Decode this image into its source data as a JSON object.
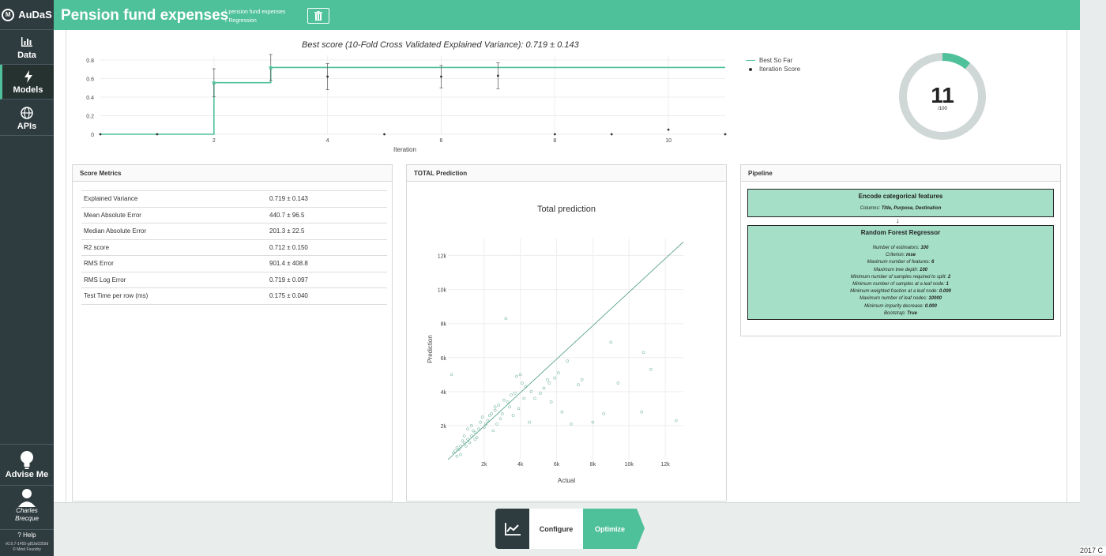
{
  "app": {
    "name": "AuDaS",
    "version": "v0.9.7-1455-g81fa0359d",
    "company": "© Mind Foundry",
    "year_fragment": "2017 C"
  },
  "sidebar": {
    "items": [
      {
        "label": "Data",
        "icon": "bar-chart-icon"
      },
      {
        "label": "Models",
        "icon": "lightning-icon"
      },
      {
        "label": "APIs",
        "icon": "globe-icon"
      }
    ],
    "advise_label": "Advise Me",
    "user_first": "Charles",
    "user_last": "Brecque",
    "help_label": "Help"
  },
  "header": {
    "title": "Pension fund expenses",
    "tags": [
      "pension fund expenses",
      "Regression"
    ]
  },
  "iteration_chart": {
    "title": "Best score (10-Fold Cross Validated Explained Variance): 0.719 ± 0.143",
    "xlabel": "Iteration",
    "y_ticks": [
      "0",
      "0.2",
      "0.4",
      "0.6",
      "0.8"
    ],
    "x_ticks": [
      "2",
      "4",
      "6",
      "8",
      "10"
    ],
    "legend": [
      "Best So Far",
      "Iteration Score"
    ]
  },
  "progress": {
    "current": "11",
    "total": "/100",
    "fraction": 0.11
  },
  "score_metrics": {
    "title": "Score Metrics",
    "rows": [
      {
        "name": "Explained Variance",
        "value": "0.719 ± 0.143"
      },
      {
        "name": "Mean Absolute Error",
        "value": "440.7 ± 96.5"
      },
      {
        "name": "Median Absolute Error",
        "value": "201.3 ± 22.5"
      },
      {
        "name": "R2 score",
        "value": "0.712 ± 0.150"
      },
      {
        "name": "RMS Error",
        "value": "901.4 ± 408.8"
      },
      {
        "name": "RMS Log Error",
        "value": "0.719 ± 0.097"
      },
      {
        "name": "Test Time per row (ms)",
        "value": "0.175 ± 0.040"
      }
    ]
  },
  "prediction": {
    "panel_title": "TOTAL Prediction",
    "plot_title": "Total prediction",
    "xlabel": "Actual",
    "ylabel": "Prediction",
    "x_ticks": [
      "2k",
      "4k",
      "6k",
      "8k",
      "10k",
      "12k"
    ],
    "y_ticks": [
      "2k",
      "4k",
      "6k",
      "8k",
      "10k",
      "12k"
    ]
  },
  "pipeline": {
    "title": "Pipeline",
    "step1": {
      "title": "Encode categorical features",
      "columns_label": "Columns:",
      "columns_value": "Title, Purpose, Destination"
    },
    "arrow": "↓",
    "step2": {
      "title": "Random Forest Regressor",
      "params": [
        {
          "k": "Number of estimators:",
          "v": "100"
        },
        {
          "k": "Criterion:",
          "v": "mse"
        },
        {
          "k": "Maximum number of features:",
          "v": "6"
        },
        {
          "k": "Maximum tree depth:",
          "v": "100"
        },
        {
          "k": "Minimum number of samples required to split:",
          "v": "2"
        },
        {
          "k": "Minimum number of samples at a leaf node:",
          "v": "1"
        },
        {
          "k": "Minimum weighted fraction at a leaf node:",
          "v": "0.000"
        },
        {
          "k": "Maximum number of leaf nodes:",
          "v": "10000"
        },
        {
          "k": "Minimum impurity decrease:",
          "v": "0.000"
        },
        {
          "k": "Bootstrap:",
          "v": "True"
        }
      ]
    }
  },
  "workflow": {
    "configure_label": "Configure",
    "optimize_label": "Optimize"
  },
  "colors": {
    "accent": "#4fc19a",
    "sidebar": "#2e3b3f",
    "donut_track": "#cfd8d6"
  },
  "chart_data": [
    {
      "type": "line",
      "title": "Best score (10-Fold Cross Validated Explained Variance): 0.719 ± 0.143",
      "xlabel": "Iteration",
      "ylabel": "",
      "xlim": [
        0,
        11
      ],
      "ylim": [
        0,
        0.85
      ],
      "series": [
        {
          "name": "Best So Far",
          "x": [
            0,
            1,
            2,
            2,
            3,
            3,
            11
          ],
          "y": [
            0,
            0,
            0,
            0.555,
            0.555,
            0.719,
            0.719
          ]
        },
        {
          "name": "Iteration Score",
          "x": [
            0,
            1,
            2,
            3,
            4,
            5,
            6,
            7,
            8,
            9,
            10,
            11
          ],
          "y": [
            0,
            0,
            0.555,
            0.719,
            0.62,
            0,
            0.62,
            0.63,
            0,
            0,
            0.05,
            0
          ],
          "err": [
            0,
            0,
            0.15,
            0.14,
            0.14,
            0,
            0.12,
            0.14,
            0,
            0,
            0,
            0
          ]
        }
      ]
    },
    {
      "type": "scatter",
      "title": "Total prediction",
      "xlabel": "Actual",
      "ylabel": "Prediction",
      "xlim": [
        0,
        13000
      ],
      "ylim": [
        0,
        13000
      ],
      "series": [
        {
          "x": [
            3200,
            9000,
            10800,
            11200,
            12600,
            8600,
            8000,
            6800,
            5700,
            4500,
            4300,
            3800,
            3500,
            3100,
            2800,
            2600,
            2400,
            2100,
            1900,
            1700,
            1500,
            1300,
            1100,
            900,
            700,
            500,
            300,
            2900,
            3300,
            3700,
            4100,
            4800,
            5100,
            5500,
            6100,
            6600,
            7200,
            7400,
            800,
            1200,
            1600,
            2000,
            2200,
            2700,
            3000,
            3400,
            3900,
            4200,
            600,
            400,
            1000,
            1400,
            1800,
            2300,
            2500,
            4600,
            5300,
            5900,
            6300,
            9400,
            10700,
            2600,
            3600,
            4000,
            1500,
            900,
            700,
            1100,
            1300,
            500,
            200,
            5600
          ],
          "y": [
            8300,
            6900,
            6300,
            5300,
            2300,
            2700,
            2200,
            2100,
            3400,
            2200,
            4300,
            4900,
            3800,
            3500,
            3200,
            2900,
            2700,
            2100,
            2500,
            1800,
            1600,
            1400,
            1200,
            1000,
            800,
            700,
            400,
            2400,
            3400,
            3900,
            4500,
            3600,
            3900,
            4700,
            5100,
            5800,
            4400,
            4700,
            1100,
            1000,
            1300,
            1900,
            2300,
            2100,
            2700,
            3100,
            3000,
            3600,
            600,
            500,
            800,
            1700,
            2200,
            2600,
            1700,
            4000,
            4200,
            4800,
            2800,
            4500,
            2800,
            3100,
            2600,
            5000,
            1200,
            1400,
            300,
            1800,
            2000,
            200,
            5000,
            4500
          ]
        }
      ]
    }
  ]
}
